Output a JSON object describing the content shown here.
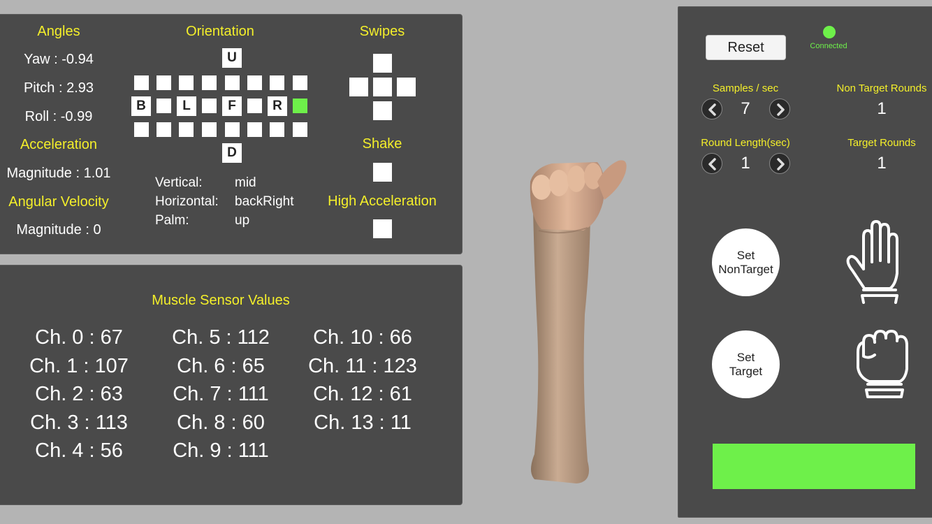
{
  "angles": {
    "title": "Angles",
    "yaw": "Yaw : -0.94",
    "pitch": "Pitch : 2.93",
    "roll": "Roll : -0.99"
  },
  "acceleration": {
    "title": "Acceleration",
    "magnitude": "Magnitude : 1.01"
  },
  "angular_velocity": {
    "title": "Angular Velocity",
    "magnitude": "Magnitude : 0"
  },
  "orientation": {
    "title": "Orientation",
    "labels": {
      "up": "U",
      "down": "D",
      "back": "B",
      "left": "L",
      "front": "F",
      "right": "R"
    },
    "active_cell": "middle-row-last",
    "vertical_label": "Vertical:",
    "vertical_value": "mid",
    "horizontal_label": "Horizontal:",
    "horizontal_value": "backRight",
    "palm_label": "Palm:",
    "palm_value": "up"
  },
  "swipes": {
    "title": "Swipes"
  },
  "shake": {
    "title": "Shake"
  },
  "high_acceleration": {
    "title": "High Acceleration"
  },
  "muscle": {
    "title": "Muscle Sensor Values",
    "channels": [
      "Ch. 0 : 67",
      "Ch. 1 : 107",
      "Ch. 2 : 63",
      "Ch. 3 : 113",
      "Ch. 4 : 56",
      "Ch. 5 : 112",
      "Ch. 6 : 65",
      "Ch. 7 : 111",
      "Ch. 8 : 60",
      "Ch. 9 : 111",
      "Ch. 10 : 66",
      "Ch. 11 : 123",
      "Ch. 12 : 61",
      "Ch. 13 : 11"
    ]
  },
  "controls": {
    "reset_label": "Reset",
    "status": "Connected",
    "samples_label": "Samples / sec",
    "samples_value": "7",
    "non_target_rounds_label": "Non Target Rounds",
    "non_target_rounds_value": "1",
    "round_length_label": "Round Length(sec)",
    "round_length_value": "1",
    "target_rounds_label": "Target Rounds",
    "target_rounds_value": "1",
    "set_nontarget_line1": "Set",
    "set_nontarget_line2": "NonTarget",
    "set_target_line1": "Set",
    "set_target_line2": "Target"
  },
  "colors": {
    "panel": "#4a4a4a",
    "background": "#b4b4b4",
    "accent_yellow": "#f4ef2a",
    "active_green": "#6ef04a"
  },
  "icons": [
    "chevron-left-icon",
    "chevron-right-icon",
    "open-hand-icon",
    "closed-fist-icon"
  ]
}
